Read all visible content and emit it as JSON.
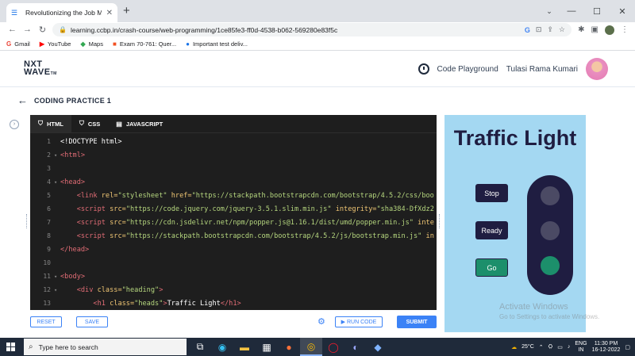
{
  "browser": {
    "tab_title": "Revolutionizing the Job Market | ",
    "url": "learning.ccbp.in/crash-course/web-programming/1ce85fe3-ff0d-4538-b062-569280e83f5c",
    "window_controls": [
      "⌄",
      "—",
      "☐",
      "✕"
    ],
    "bookmarks": [
      {
        "icon": "G",
        "label": "Gmail",
        "color": "#ea4335"
      },
      {
        "icon": "▶",
        "label": "YouTube",
        "color": "#ff0000"
      },
      {
        "icon": "◆",
        "label": "Maps",
        "color": "#34a853"
      },
      {
        "icon": "■",
        "label": "Exam 70-761: Quer...",
        "color": "#f25022"
      },
      {
        "icon": "●",
        "label": "Important test deliv...",
        "color": "#1a73e8"
      }
    ]
  },
  "header": {
    "logo_line1": "NXT",
    "logo_line2": "WAVE",
    "logo_tm": "TM",
    "code_playground": "Code Playground",
    "user_name": "Tulasi Rama Kumari"
  },
  "page": {
    "title": "CODING PRACTICE 1"
  },
  "editor": {
    "tabs": [
      "HTML",
      "CSS",
      "JAVASCRIPT"
    ],
    "active_tab": "HTML",
    "lines": [
      {
        "n": "1",
        "fold": "",
        "indent": "",
        "parts": [
          {
            "c": "tx",
            "t": "<!DOCTYPE html>"
          }
        ]
      },
      {
        "n": "2",
        "fold": "▾",
        "indent": "",
        "parts": [
          {
            "c": "tg",
            "t": "<html>"
          }
        ]
      },
      {
        "n": "3",
        "fold": "",
        "indent": "",
        "parts": []
      },
      {
        "n": "4",
        "fold": "▾",
        "indent": "",
        "parts": [
          {
            "c": "tg",
            "t": "<head>"
          }
        ]
      },
      {
        "n": "5",
        "fold": "",
        "indent": "    ",
        "parts": [
          {
            "c": "tg",
            "t": "<link "
          },
          {
            "c": "at",
            "t": "rel="
          },
          {
            "c": "st",
            "t": "\"stylesheet\" "
          },
          {
            "c": "at",
            "t": "href="
          },
          {
            "c": "st",
            "t": "\"https://stackpath.bootstrapcdn.com/bootstrap/4.5.2/css/boo"
          }
        ]
      },
      {
        "n": "6",
        "fold": "",
        "indent": "    ",
        "parts": [
          {
            "c": "tg",
            "t": "<script "
          },
          {
            "c": "at",
            "t": "src="
          },
          {
            "c": "st",
            "t": "\"https://code.jquery.com/jquery-3.5.1.slim.min.js\" "
          },
          {
            "c": "at",
            "t": "integrity="
          },
          {
            "c": "st",
            "t": "\"sha384-DfXdz2"
          }
        ]
      },
      {
        "n": "7",
        "fold": "",
        "indent": "    ",
        "parts": [
          {
            "c": "tg",
            "t": "<script "
          },
          {
            "c": "at",
            "t": "src="
          },
          {
            "c": "st",
            "t": "\"https://cdn.jsdelivr.net/npm/popper.js@1.16.1/dist/umd/popper.min.js\" "
          },
          {
            "c": "at",
            "t": "inte"
          }
        ]
      },
      {
        "n": "8",
        "fold": "",
        "indent": "    ",
        "parts": [
          {
            "c": "tg",
            "t": "<script "
          },
          {
            "c": "at",
            "t": "src="
          },
          {
            "c": "st",
            "t": "\"https://stackpath.bootstrapcdn.com/bootstrap/4.5.2/js/bootstrap.min.js\" "
          },
          {
            "c": "at",
            "t": "in"
          }
        ]
      },
      {
        "n": "9",
        "fold": "",
        "indent": "",
        "parts": [
          {
            "c": "tg",
            "t": "</head>"
          }
        ]
      },
      {
        "n": "10",
        "fold": "",
        "indent": "",
        "parts": []
      },
      {
        "n": "11",
        "fold": "▾",
        "indent": "",
        "parts": [
          {
            "c": "tg",
            "t": "<body>"
          }
        ]
      },
      {
        "n": "12",
        "fold": "▾",
        "indent": "    ",
        "parts": [
          {
            "c": "tg",
            "t": "<div "
          },
          {
            "c": "at",
            "t": "class="
          },
          {
            "c": "st",
            "t": "\"heading\""
          },
          {
            "c": "tg",
            "t": ">"
          }
        ]
      },
      {
        "n": "13",
        "fold": "",
        "indent": "        ",
        "parts": [
          {
            "c": "tg",
            "t": "<h1 "
          },
          {
            "c": "at",
            "t": "class="
          },
          {
            "c": "st",
            "t": "\"heads\""
          },
          {
            "c": "tg",
            "t": ">"
          },
          {
            "c": "tx",
            "t": "Traffic Light"
          },
          {
            "c": "tg",
            "t": "</h1>"
          }
        ]
      }
    ]
  },
  "actions": {
    "reset": "RESET",
    "save": "SAVE",
    "run": "▶ RUN CODE",
    "submit": "SUBMIT"
  },
  "preview": {
    "title": "Traffic Light",
    "buttons": [
      "Stop",
      "Ready",
      "Go"
    ],
    "active_light": "Go",
    "colors": {
      "bg": "#a4d8f2",
      "dark": "#1f1d41",
      "green": "#1c8f6b",
      "off": "#4b4a64"
    }
  },
  "watermark": {
    "line1": "Activate Windows",
    "line2": "Go to Settings to activate Windows."
  },
  "taskbar": {
    "search_placeholder": "Type here to search",
    "temperature": "25°C",
    "lang_top": "ENG",
    "lang_bottom": "IN",
    "time": "11:30 PM",
    "date": "16-12-2022"
  }
}
